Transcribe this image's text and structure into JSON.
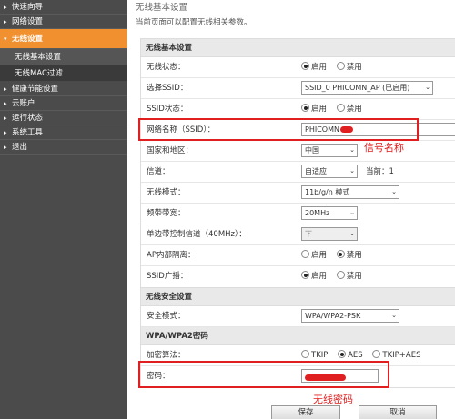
{
  "sidebar": {
    "items": [
      {
        "label": "快速向导"
      },
      {
        "label": "网络设置"
      },
      {
        "label": "无线设置"
      },
      {
        "label": "健康节能设置"
      },
      {
        "label": "云账户"
      },
      {
        "label": "运行状态"
      },
      {
        "label": "系统工具"
      },
      {
        "label": "退出"
      }
    ],
    "subitems": [
      {
        "label": "无线基本设置"
      },
      {
        "label": "无线MAC过滤"
      }
    ]
  },
  "header": {
    "title": "无线基本设置",
    "description": "当前页面可以配置无线相关参数。"
  },
  "basic": {
    "section_title": "无线基本设置",
    "wireless_status": {
      "label": "无线状态：",
      "opt_on": "启用",
      "opt_off": "禁用"
    },
    "select_ssid": {
      "label": "选择SSID：",
      "value": "SSID_0 PHICOMN_AP (已启用)"
    },
    "ssid_status": {
      "label": "SSID状态：",
      "opt_on": "启用",
      "opt_off": "禁用"
    },
    "ssid_name": {
      "label": "网络名称（SSID）：",
      "value": "PHICOMN"
    },
    "country": {
      "label": "国家和地区：",
      "value": "中国"
    },
    "channel": {
      "label": "信道：",
      "value": "自适应",
      "current": "当前：1"
    },
    "mode": {
      "label": "无线模式：",
      "value": "11b/g/n 模式"
    },
    "bandwidth": {
      "label": "频带带宽：",
      "value": "20MHz"
    },
    "sideband": {
      "label": "单边带控制信道（40MHz）：",
      "value": "下"
    },
    "ap_isolation": {
      "label": "AP内部隔离：",
      "opt_on": "启用",
      "opt_off": "禁用"
    },
    "ssid_broadcast": {
      "label": "SSID广播：",
      "opt_on": "启用",
      "opt_off": "禁用"
    }
  },
  "security": {
    "section_title": "无线安全设置",
    "mode": {
      "label": "安全模式：",
      "value": "WPA/WPA2-PSK"
    },
    "wpa_title": "WPA/WPA2密码",
    "encryption": {
      "label": "加密算法：",
      "opt_tkip": "TKIP",
      "opt_aes": "AES",
      "opt_both": "TKIP+AES"
    },
    "password": {
      "label": "密码："
    }
  },
  "annotations": {
    "ssid_note": "信号名称",
    "password_note": "无线密码"
  },
  "buttons": {
    "save": "保存",
    "cancel": "取消"
  },
  "colors": {
    "sidebar_bg": "#4b4b4b",
    "active_orange": "#f0902e",
    "annotation_red": "#e02020"
  }
}
